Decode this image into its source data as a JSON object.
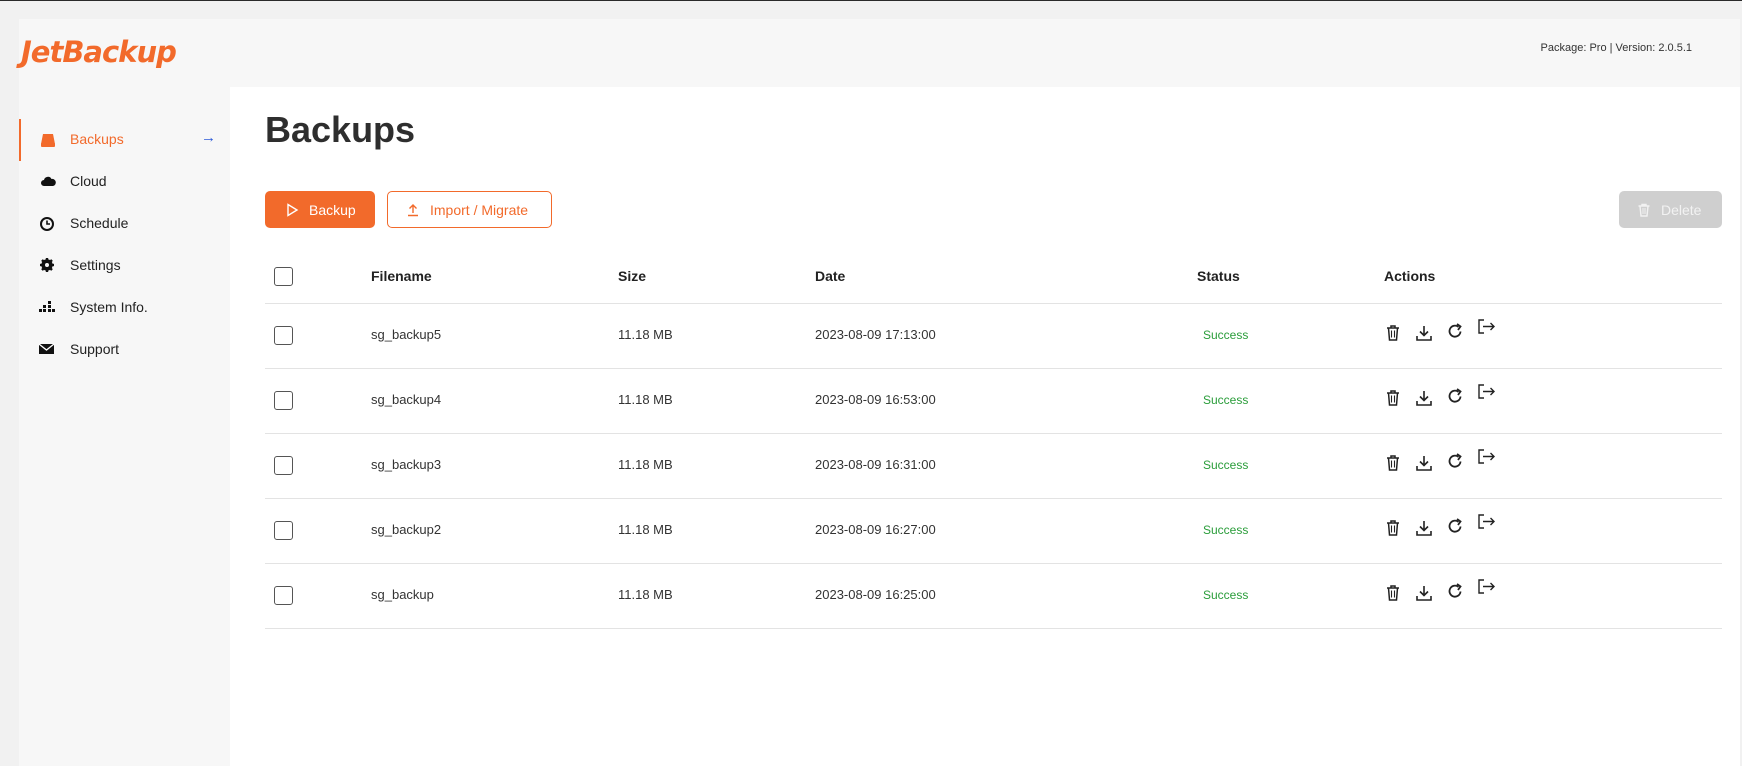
{
  "app": {
    "logo_text": "JetBackup",
    "package_info": "Package: Pro | Version: 2.0.5.1",
    "accent_color": "#f26a2b"
  },
  "sidebar": {
    "items": [
      {
        "label": "Backups",
        "icon": "drive-icon",
        "active": true
      },
      {
        "label": "Cloud",
        "icon": "cloud-icon"
      },
      {
        "label": "Schedule",
        "icon": "clock-icon"
      },
      {
        "label": "Settings",
        "icon": "gear-icon"
      },
      {
        "label": "System Info.",
        "icon": "grid-icon"
      },
      {
        "label": "Support",
        "icon": "envelope-icon"
      }
    ],
    "active_arrow": "→"
  },
  "main": {
    "title": "Backups",
    "buttons": {
      "backup_label": "Backup",
      "import_label": "Import / Migrate",
      "delete_label": "Delete"
    },
    "table": {
      "headers": {
        "filename": "Filename",
        "size": "Size",
        "date": "Date",
        "status": "Status",
        "actions": "Actions"
      },
      "rows": [
        {
          "filename": "sg_backup5",
          "size": "11.18 MB",
          "date": "2023-08-09 17:13:00",
          "status": "Success"
        },
        {
          "filename": "sg_backup4",
          "size": "11.18 MB",
          "date": "2023-08-09 16:53:00",
          "status": "Success"
        },
        {
          "filename": "sg_backup3",
          "size": "11.18 MB",
          "date": "2023-08-09 16:31:00",
          "status": "Success"
        },
        {
          "filename": "sg_backup2",
          "size": "11.18 MB",
          "date": "2023-08-09 16:27:00",
          "status": "Success"
        },
        {
          "filename": "sg_backup",
          "size": "11.18 MB",
          "date": "2023-08-09 16:25:00",
          "status": "Success"
        }
      ],
      "row_actions": [
        "trash-icon",
        "download-icon",
        "restore-icon",
        "export-icon"
      ]
    }
  }
}
